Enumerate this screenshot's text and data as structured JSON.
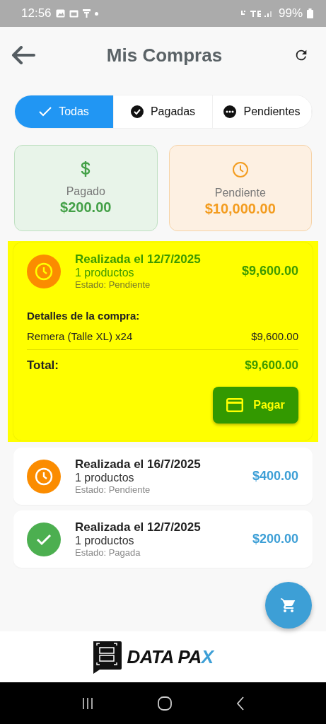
{
  "status_bar": {
    "time": "12:56",
    "battery": "99%"
  },
  "app_bar": {
    "title": "Mis Compras"
  },
  "filters": [
    {
      "label": "Todas",
      "kind": "all",
      "selected": true
    },
    {
      "label": "Pagadas",
      "kind": "paid",
      "selected": false
    },
    {
      "label": "Pendientes",
      "kind": "pending",
      "selected": false
    }
  ],
  "summary": [
    {
      "kind": "paid",
      "label": "Pagado",
      "amount": "$200.00"
    },
    {
      "kind": "pending",
      "label": "Pendiente",
      "amount": "$10,000.00"
    }
  ],
  "orders": [
    {
      "title": "Realizada el 12/7/2025",
      "count": "1 productos",
      "status": "Estado: Pendiente",
      "kind": "pending",
      "amount": "$9,600.00",
      "selected": true,
      "details": {
        "heading": "Detalles de la compra:",
        "items": [
          {
            "name": "Remera (Talle XL) x24",
            "price": "$9,600.00"
          }
        ],
        "total_label": "Total:",
        "total": "$9,600.00",
        "pay_button": "Pagar"
      }
    },
    {
      "title": "Realizada el 16/7/2025",
      "count": "1 productos",
      "status": "Estado: Pendiente",
      "kind": "pending",
      "amount": "$400.00",
      "selected": false
    },
    {
      "title": "Realizada el 12/7/2025",
      "count": "1 productos",
      "status": "Estado: Pagada",
      "kind": "paid",
      "amount": "$200.00",
      "selected": false
    }
  ],
  "footer": {
    "brand": "DATA PA",
    "brand_accent": "X"
  }
}
